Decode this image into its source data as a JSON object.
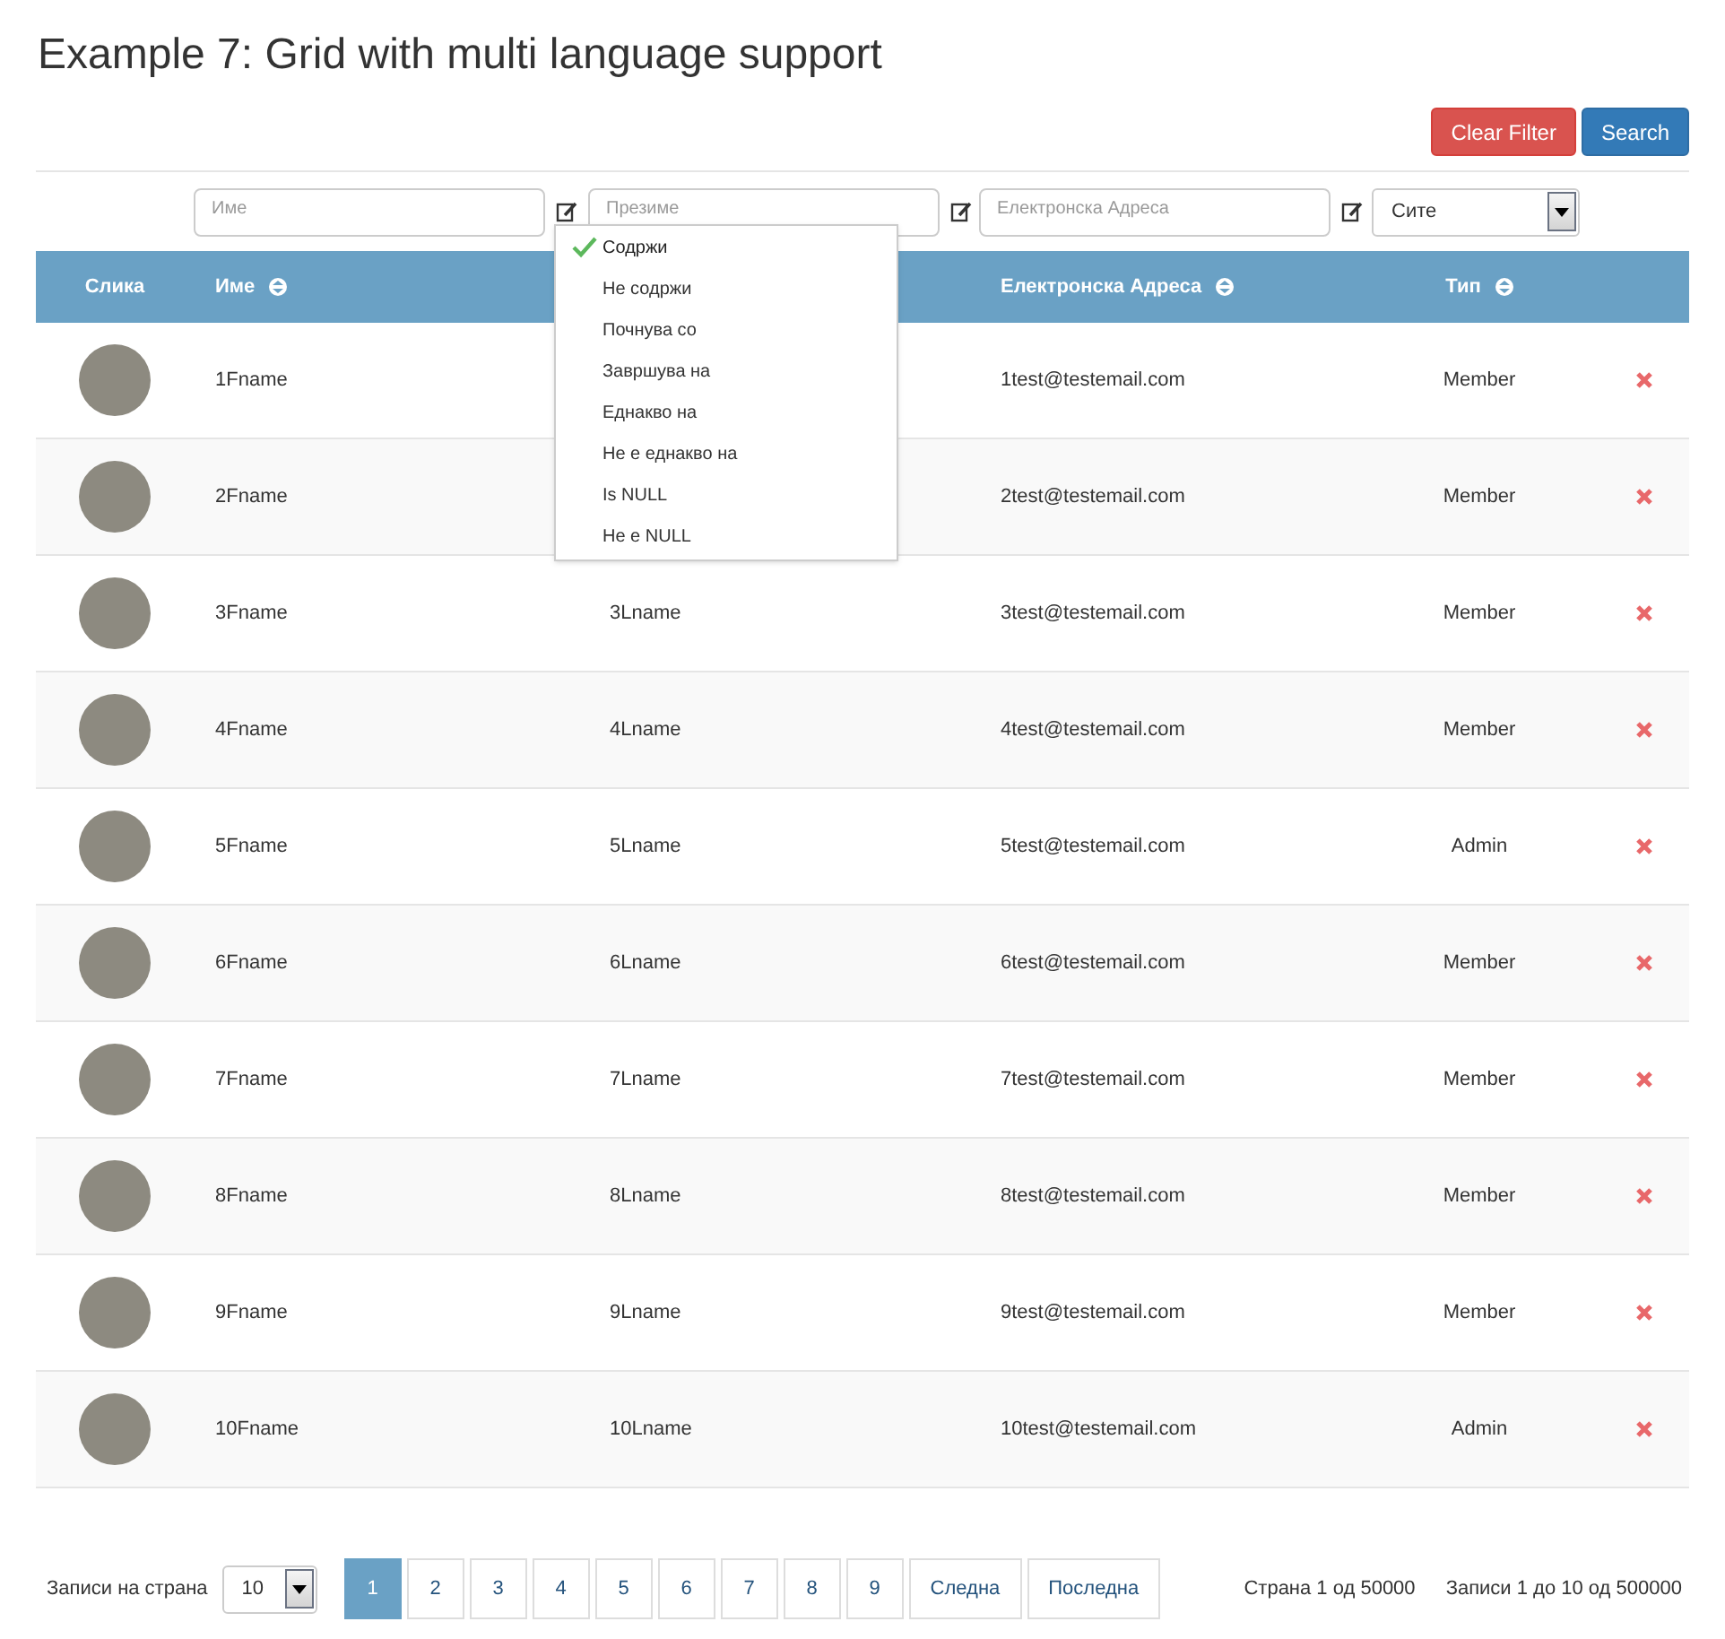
{
  "title": "Example 7: Grid with multi language support",
  "buttons": [
    {
      "label": "Clear Filter",
      "kind": "danger"
    },
    {
      "label": "Search",
      "kind": "primary"
    }
  ],
  "filters": [
    {
      "kind": "text",
      "placeholder": "Име"
    },
    {
      "kind": "text",
      "placeholder": "Презиме"
    },
    {
      "kind": "text",
      "placeholder": "Електронска Адреса"
    },
    {
      "kind": "select",
      "value": "Сите"
    }
  ],
  "filter_menu": {
    "items": [
      {
        "label": "Содржи",
        "selected": true
      },
      {
        "label": "Не содржи",
        "selected": false
      },
      {
        "label": "Почнува со",
        "selected": false
      },
      {
        "label": "Завршува на",
        "selected": false
      },
      {
        "label": "Еднакво на",
        "selected": false
      },
      {
        "label": "Не е еднакво на",
        "selected": false
      },
      {
        "label": "Is NULL",
        "selected": false
      },
      {
        "label": "Не е NULL",
        "selected": false
      }
    ]
  },
  "table": {
    "columns": [
      {
        "label": "Слика",
        "sortable": false
      },
      {
        "label": "Име",
        "sortable": true
      },
      {
        "label": "Електронска Адреса",
        "sortable": true
      },
      {
        "label": "Тип",
        "sortable": true
      }
    ],
    "rows": [
      {
        "first": "1Fname",
        "email": "1test@testemail.com",
        "type": "Member"
      },
      {
        "first": "2Fname",
        "email": "2test@testemail.com",
        "type": "Member"
      },
      {
        "first": "3Fname",
        "last": "3Lname",
        "email": "3test@testemail.com",
        "type": "Member"
      },
      {
        "first": "4Fname",
        "last": "4Lname",
        "email": "4test@testemail.com",
        "type": "Member"
      },
      {
        "first": "5Fname",
        "last": "5Lname",
        "email": "5test@testemail.com",
        "type": "Admin"
      },
      {
        "first": "6Fname",
        "last": "6Lname",
        "email": "6test@testemail.com",
        "type": "Member"
      },
      {
        "first": "7Fname",
        "last": "7Lname",
        "email": "7test@testemail.com",
        "type": "Member"
      },
      {
        "first": "8Fname",
        "last": "8Lname",
        "email": "8test@testemail.com",
        "type": "Member"
      },
      {
        "first": "9Fname",
        "last": "9Lname",
        "email": "9test@testemail.com",
        "type": "Member"
      },
      {
        "first": "10Fname",
        "last": "10Lname",
        "email": "10test@testemail.com",
        "type": "Admin"
      }
    ]
  },
  "pagination": {
    "page_size_label": "Записи на страна",
    "page_size": "10",
    "pages": [
      {
        "label": "1",
        "selected": true
      },
      {
        "label": "2",
        "selected": false
      },
      {
        "label": "3",
        "selected": false
      },
      {
        "label": "4",
        "selected": false
      },
      {
        "label": "5",
        "selected": false
      },
      {
        "label": "6",
        "selected": false
      },
      {
        "label": "7",
        "selected": false
      },
      {
        "label": "8",
        "selected": false
      },
      {
        "label": "9",
        "selected": false
      },
      {
        "label": "Следна",
        "selected": false
      },
      {
        "label": "Последна",
        "selected": false
      }
    ],
    "page_info": "Страна 1 од 50000",
    "records_info": "Записи 1 до 10 од 500000"
  }
}
